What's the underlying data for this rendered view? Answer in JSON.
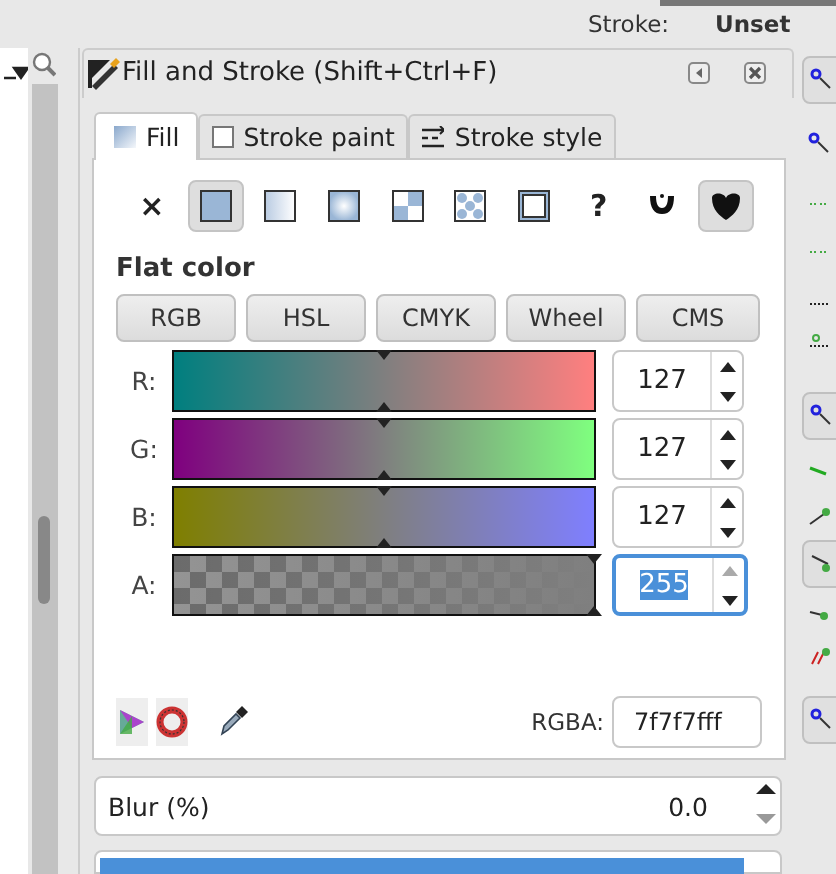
{
  "status": {
    "label": "Stroke:",
    "value": "Unset"
  },
  "dialog": {
    "title": "Fill and Stroke (Shift+Ctrl+F)"
  },
  "tabs": [
    {
      "label": "Fill",
      "kind": "fill",
      "selected": true
    },
    {
      "label": "Stroke paint",
      "kind": "paint",
      "selected": false
    },
    {
      "label": "Stroke style",
      "kind": "style",
      "selected": false
    }
  ],
  "paint_types": [
    {
      "kind": "none",
      "label": "×",
      "selected": false
    },
    {
      "kind": "flat",
      "selected": true
    },
    {
      "kind": "linear",
      "selected": false
    },
    {
      "kind": "radial",
      "selected": false
    },
    {
      "kind": "mesh",
      "selected": false
    },
    {
      "kind": "pattern",
      "selected": false
    },
    {
      "kind": "swatch",
      "selected": false
    },
    {
      "kind": "unset",
      "label": "?",
      "selected": false
    }
  ],
  "fill_rules": [
    {
      "kind": "evenodd",
      "selected": false
    },
    {
      "kind": "nonzero",
      "selected": true
    }
  ],
  "section_title": "Flat color",
  "modes": [
    "RGB",
    "HSL",
    "CMYK",
    "Wheel",
    "CMS"
  ],
  "channels": [
    {
      "label": "R:",
      "value": "127",
      "level": 0.5,
      "focused": false
    },
    {
      "label": "G:",
      "value": "127",
      "level": 0.5,
      "focused": false
    },
    {
      "label": "B:",
      "value": "127",
      "level": 0.5,
      "focused": false
    },
    {
      "label": "A:",
      "value": "255",
      "level": 1.0,
      "focused": true
    }
  ],
  "rgba": {
    "label": "RGBA:",
    "value": "7f7f7fff"
  },
  "blur": {
    "label": "Blur (%)",
    "value": "0.0"
  },
  "opacity": {
    "level": 1.0
  }
}
